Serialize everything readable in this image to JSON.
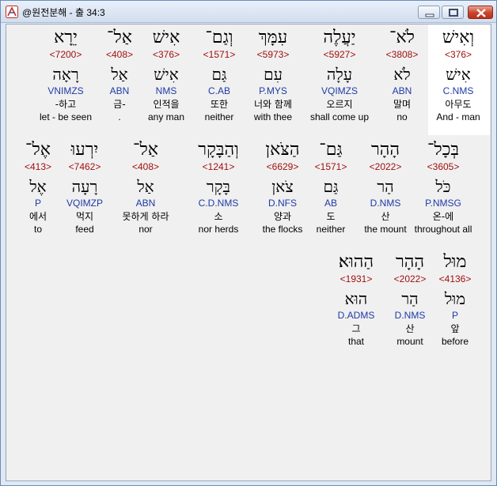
{
  "window": {
    "title": "@원전분해 - 출 34:3",
    "minimize_label": "minimize",
    "maximize_label": "maximize",
    "close_label": "close"
  },
  "rows": [
    {
      "words": [
        {
          "heb": "וְאִישׁ",
          "strong": "<376>",
          "lemma": "אִישׁ",
          "morph": "C.NMS",
          "kor": "아무도",
          "eng": "And - man"
        },
        {
          "heb": "לֹא־",
          "strong": "<3808>",
          "lemma": "לֹא",
          "morph": "ABN",
          "kor": "말며",
          "eng": "no"
        },
        {
          "heb": "יַעֲלֶה",
          "strong": "<5927>",
          "lemma": "עָלָה",
          "morph": "VQIMZS",
          "kor": "오르지",
          "eng": "shall come up"
        },
        {
          "heb": "עִמָּךְ",
          "strong": "<5973>",
          "lemma": "עִם",
          "morph": "P.MYS",
          "kor": "너와 함께",
          "eng": "with thee"
        },
        {
          "heb": "וְגַם־",
          "strong": "<1571>",
          "lemma": "גַּם",
          "morph": "C.AB",
          "kor": "또한",
          "eng": "neither"
        },
        {
          "heb": "אִישׁ",
          "strong": "<376>",
          "lemma": "אִישׁ",
          "morph": "NMS",
          "kor": "인적을",
          "eng": "any man"
        },
        {
          "heb": "אַל־",
          "strong": "<408>",
          "lemma": "אַל",
          "morph": "ABN",
          "kor": "금-",
          "eng": "."
        },
        {
          "heb": "יֵרָא",
          "strong": "<7200>",
          "lemma": "רָאָה",
          "morph": "VNIMZS",
          "kor": "-하고",
          "eng": "let - be seen"
        }
      ]
    },
    {
      "words": [
        {
          "heb": "בְּכָל־",
          "strong": "<3605>",
          "lemma": "כֹּל",
          "morph": "P.NMSG",
          "kor": "온-에",
          "eng": "throughout all"
        },
        {
          "heb": "הָהָר",
          "strong": "<2022>",
          "lemma": "הַר",
          "morph": "D.NMS",
          "kor": "산",
          "eng": "the mount"
        },
        {
          "heb": "גַּם־",
          "strong": "<1571>",
          "lemma": "גַּם",
          "morph": "AB",
          "kor": "도",
          "eng": "neither"
        },
        {
          "heb": "הַצֹּאן",
          "strong": "<6629>",
          "lemma": "צֹאן",
          "morph": "D.NFS",
          "kor": "양과",
          "eng": "the flocks"
        },
        {
          "heb": "וְהַבָּקָר",
          "strong": "<1241>",
          "lemma": "בָּקָר",
          "morph": "C.D.NMS",
          "kor": "소",
          "eng": "nor herds"
        },
        {
          "heb": "אַל־",
          "strong": "<408>",
          "lemma": "אַל",
          "morph": "ABN",
          "kor": "못하게 하라",
          "eng": "nor"
        },
        {
          "heb": "יִרְעוּ",
          "strong": "<7462>",
          "lemma": "רָעָה",
          "morph": "VQIMZP",
          "kor": "먹지",
          "eng": "feed"
        },
        {
          "heb": "אֶל־",
          "strong": "<413>",
          "lemma": "אֶל",
          "morph": "P",
          "kor": "에서",
          "eng": "to"
        }
      ]
    },
    {
      "words": [
        {
          "heb": "מוּל",
          "strong": "<4136>",
          "lemma": "מוּל",
          "morph": "P",
          "kor": "앞",
          "eng": "before"
        },
        {
          "heb": "הָהָר",
          "strong": "<2022>",
          "lemma": "הַר",
          "morph": "D.NMS",
          "kor": "산",
          "eng": "mount"
        },
        {
          "heb": "הַהוּא׃",
          "strong": "<1931>",
          "lemma": "הוּא",
          "morph": "D.ADMS",
          "kor": "그",
          "eng": "that"
        }
      ]
    }
  ]
}
